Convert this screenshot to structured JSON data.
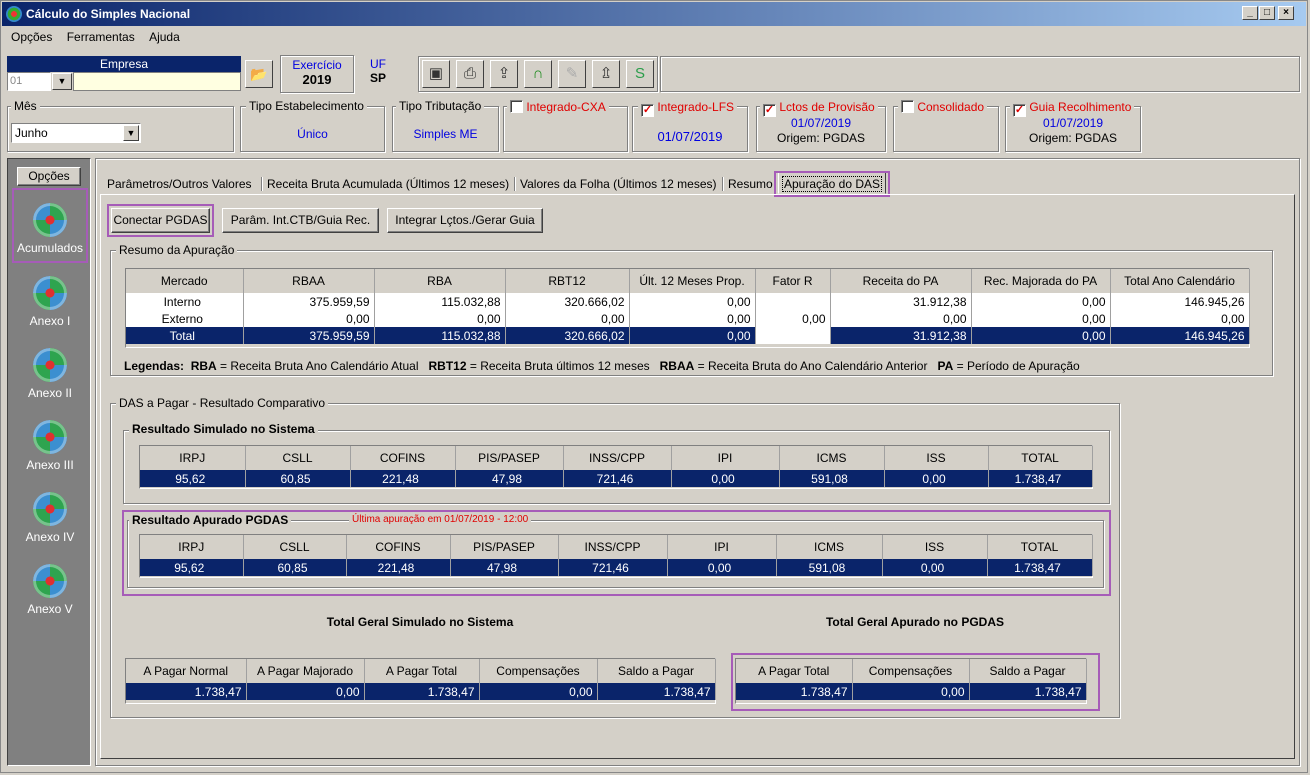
{
  "window": {
    "title": "Cálculo do Simples Nacional",
    "controls": [
      "_",
      "□",
      "×"
    ]
  },
  "menu": [
    "Opções",
    "Ferramentas",
    "Ajuda"
  ],
  "empresa": {
    "label": "Empresa",
    "code": "01"
  },
  "exercicio": {
    "label": "Exercício",
    "value": "2019"
  },
  "uf": {
    "label": "UF",
    "value": "SP"
  },
  "mes": {
    "label": "Mês",
    "value": "Junho"
  },
  "tipo_estabelecimento": {
    "label": "Tipo Estabelecimento",
    "value": "Único"
  },
  "tipo_tributacao": {
    "label": "Tipo Tributação",
    "value": "Simples ME"
  },
  "checks": {
    "integrado_cxa": {
      "label": "Integrado-CXA",
      "checked": false
    },
    "integrado_lfs": {
      "label": "Integrado-LFS",
      "checked": true,
      "date": "01/07/2019"
    },
    "lctos_provisao": {
      "label": "Lctos de Provisão",
      "checked": true,
      "date": "01/07/2019",
      "origin": "Origem: PGDAS"
    },
    "consolidado": {
      "label": "Consolidado",
      "checked": false
    },
    "guia_recolhimento": {
      "label": "Guia Recolhimento",
      "checked": true,
      "date": "01/07/2019",
      "origin": "Origem: PGDAS"
    }
  },
  "sidebar": {
    "header": "Opções",
    "items": [
      "Acumulados",
      "Anexo I",
      "Anexo II",
      "Anexo III",
      "Anexo IV",
      "Anexo V"
    ]
  },
  "tabs": [
    "Parâmetros/Outros Valores",
    "Receita Bruta Acumulada (Últimos 12 meses)",
    "Valores da Folha (Últimos 12 meses)",
    "Resumo",
    "Apuração do DAS"
  ],
  "actions": {
    "conectar": "Conectar PGDAS",
    "param": "Parâm. Int.CTB/Guia Rec.",
    "integrar": "Integrar Lçtos./Gerar Guia"
  },
  "resumo": {
    "legend": "Resumo da Apuração",
    "headers": [
      "Mercado",
      "RBAA",
      "RBA",
      "RBT12",
      "Últ. 12 Meses Prop.",
      "Fator R",
      "Receita do PA",
      "Rec. Majorada do PA",
      "Total Ano Calendário"
    ],
    "rows": [
      [
        "Interno",
        "375.959,59",
        "115.032,88",
        "320.666,02",
        "0,00",
        "",
        "31.912,38",
        "0,00",
        "146.945,26"
      ],
      [
        "Externo",
        "0,00",
        "0,00",
        "0,00",
        "0,00",
        "0,00",
        "0,00",
        "0,00",
        "0,00"
      ],
      [
        "Total",
        "375.959,59",
        "115.032,88",
        "320.666,02",
        "0,00",
        "",
        "31.912,38",
        "0,00",
        "146.945,26"
      ]
    ]
  },
  "legendas": {
    "label": "Legendas:",
    "items": [
      {
        "k": "RBA",
        "v": "= Receita Bruta Ano Calendário Atual"
      },
      {
        "k": "RBT12",
        "v": "= Receita Bruta últimos 12 meses"
      },
      {
        "k": "RBAA",
        "v": "= Receita Bruta do Ano Calendário Anterior"
      },
      {
        "k": "PA",
        "v": "= Período de Apuração"
      }
    ]
  },
  "das": {
    "legend": "DAS a Pagar - Resultado Comparativo",
    "tax_headers": [
      "IRPJ",
      "CSLL",
      "COFINS",
      "PIS/PASEP",
      "INSS/CPP",
      "IPI",
      "ICMS",
      "ISS",
      "TOTAL"
    ],
    "simulado": {
      "title": "Resultado Simulado no Sistema",
      "values": [
        "95,62",
        "60,85",
        "221,48",
        "47,98",
        "721,46",
        "0,00",
        "591,08",
        "0,00",
        "1.738,47"
      ]
    },
    "apurado": {
      "title": "Resultado Apurado PGDAS",
      "note": "Última apuração em 01/07/2019 - 12:00",
      "values": [
        "95,62",
        "60,85",
        "221,48",
        "47,98",
        "721,46",
        "0,00",
        "591,08",
        "0,00",
        "1.738,47"
      ]
    }
  },
  "totais": {
    "simulado": {
      "title": "Total Geral Simulado no Sistema",
      "headers": [
        "A Pagar Normal",
        "A Pagar Majorado",
        "A Pagar Total",
        "Compensações",
        "Saldo a Pagar"
      ],
      "values": [
        "1.738,47",
        "0,00",
        "1.738,47",
        "0,00",
        "1.738,47"
      ]
    },
    "apurado": {
      "title": "Total Geral Apurado no PGDAS",
      "headers": [
        "A Pagar Total",
        "Compensações",
        "Saldo a Pagar"
      ],
      "values": [
        "1.738,47",
        "0,00",
        "1.738,47"
      ]
    }
  },
  "colors": {
    "accent": "#0a246a",
    "highlight": "#a65cb8",
    "alert": "#e00000"
  }
}
